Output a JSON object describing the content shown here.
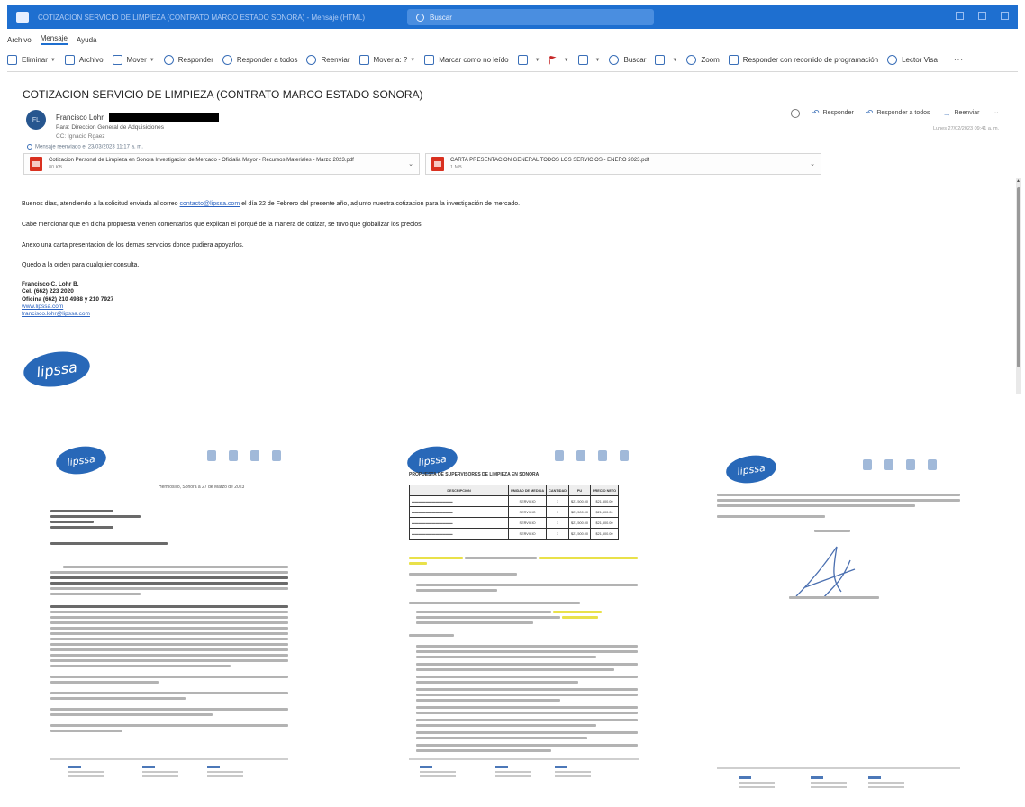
{
  "window": {
    "title": "COTIZACION SERVICIO DE LIMPIEZA (CONTRATO MARCO ESTADO SONORA) - Mensaje (HTML)",
    "search_placeholder": "Buscar"
  },
  "menu": {
    "items": [
      "Archivo",
      "Mensaje",
      "Ayuda"
    ]
  },
  "ribbon": {
    "eliminar": "Eliminar",
    "archivo": "Archivo",
    "mover": "Mover",
    "responder": "Responder",
    "responder_todos": "Responder a todos",
    "reenviar": "Reenviar",
    "mover_a": "Mover a: ?",
    "marcar": "Marcar como no leído",
    "buscar": "Buscar",
    "zoom": "Zoom",
    "responder_programacion": "Responder con recorrido de programación",
    "lector": "Lector Visa",
    "more": "···"
  },
  "message": {
    "subject": "COTIZACION SERVICIO DE LIMPIEZA (CONTRATO MARCO ESTADO SONORA)",
    "avatar_initials": "FL",
    "sender": "Francisco Lohr",
    "to": "Para: Direccion General de Adquisiciones",
    "cc": "CC: Ignacio Rgaez",
    "sent_notice": "Mensaje reenviado el 23/03/2023 11:17 a. m.",
    "date": "Lunes 27/02/2023 09:41 a. m.",
    "actions": {
      "responder": "Responder",
      "responder_todos": "Responder a todos",
      "reenviar": "Reenviar",
      "more": "···"
    },
    "attachments": [
      {
        "name": "Cotizacion Personal de Limpieza en Sonora Investigacion de Mercado - Oficialia Mayor - Recursos Materiales - Marzo 2023.pdf",
        "size": "80 KB"
      },
      {
        "name": "CARTA PRESENTACION GENERAL TODOS LOS SERVICIOS - ENERO 2023.pdf",
        "size": "1 MB"
      }
    ],
    "body": {
      "p1_before": "Buenos días, atendiendo a la solicitud enviada al correo ",
      "p1_link": "contacto@lipssa.com",
      "p1_after": " el día 22 de Febrero del presente año, adjunto nuestra cotizacion para la investigación de mercado.",
      "p2": "Cabe mencionar que en dicha propuesta vienen comentarios que explican el porqué de la manera de cotizar, se tuvo que globalizar los precios.",
      "p3": "Anexo una carta presentacion de los demas servicios donde pudiera apoyarlos.",
      "p4": "Quedo a la orden para cualquier consulta."
    },
    "signature": {
      "name": "Francisco C. Lohr B.",
      "cel": "Cel. (662) 223 2020",
      "oficina": "Oficina (662) 210 4988 y 210 7927",
      "web": "www.lipssa.com",
      "email": "francisco.lohr@lipssa.com"
    },
    "logo": "lipssa"
  },
  "pages": {
    "logo": "lipssa",
    "page1": {
      "date": "Hermosillo, Sonora a 27 de Marzo de 2023"
    },
    "page2": {
      "title": "PROPUESTA DE SUPERVISORES DE LIMPIEZA EN SONORA",
      "table": {
        "headers": [
          "DESCRIPCION",
          "UNIDAD DE MEDIDA",
          "CANTIDAD",
          "PU",
          "PRECIO NETO"
        ],
        "rows": [
          [
            "",
            "SERVICIO",
            "1",
            "$21,500.00",
            "$21,500.00"
          ],
          [
            "",
            "SERVICIO",
            "1",
            "$21,500.00",
            "$21,500.00"
          ],
          [
            "",
            "SERVICIO",
            "1",
            "$21,500.00",
            "$21,500.00"
          ],
          [
            "",
            "SERVICIO",
            "1",
            "$21,500.00",
            "$21,500.00"
          ]
        ]
      }
    }
  }
}
